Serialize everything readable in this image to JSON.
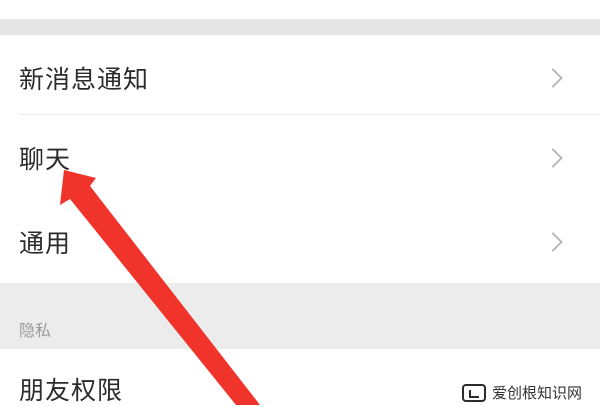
{
  "settings": {
    "items": [
      {
        "label": "新消息通知",
        "icon": "chevron-right-icon"
      },
      {
        "label": "聊天",
        "icon": "chevron-right-icon"
      },
      {
        "label": "通用",
        "icon": "chevron-right-icon"
      }
    ],
    "section_privacy": {
      "header": "隐私",
      "items": [
        {
          "label": "朋友权限"
        }
      ]
    }
  },
  "annotation": {
    "arrow_color": "#f0332b",
    "target": "聊天"
  },
  "watermark": {
    "text": "爱创根知识网"
  },
  "colors": {
    "background": "#ffffff",
    "separator_band": "#e6e6e6",
    "section_header": "#ececec",
    "text": "#2b2b2b",
    "chevron": "#b8b8b8"
  }
}
